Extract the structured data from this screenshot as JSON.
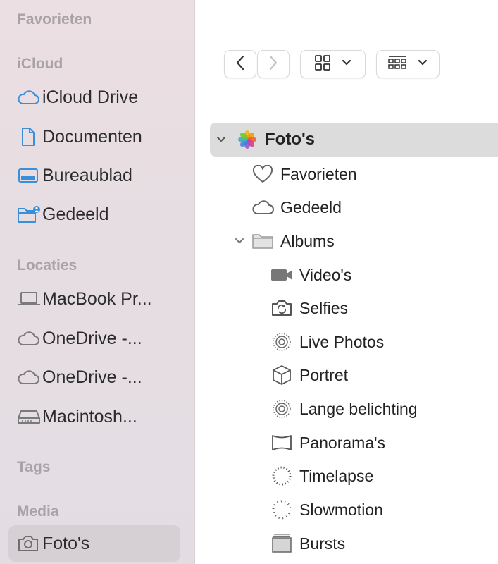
{
  "sidebar": {
    "sections": {
      "favorites": "Favorieten",
      "icloud": "iCloud",
      "locations": "Locaties",
      "tags": "Tags",
      "media": "Media"
    },
    "icloud_items": [
      {
        "label": "iCloud Drive",
        "icon": "cloud-icon"
      },
      {
        "label": "Documenten",
        "icon": "document-icon"
      },
      {
        "label": "Bureaublad",
        "icon": "desktop-icon"
      },
      {
        "label": "Gedeeld",
        "icon": "shared-folder-icon"
      }
    ],
    "location_items": [
      {
        "label": "MacBook Pr...",
        "icon": "laptop-icon"
      },
      {
        "label": "OneDrive -...",
        "icon": "cloud-icon"
      },
      {
        "label": "OneDrive -...",
        "icon": "cloud-icon"
      },
      {
        "label": "Macintosh...",
        "icon": "drive-icon"
      }
    ],
    "media_items": [
      {
        "label": "Foto's",
        "icon": "camera-icon",
        "selected": true
      }
    ]
  },
  "toolbar": {
    "back": "back-chevron-icon",
    "forward": "forward-chevron-icon",
    "view_mode": "grid-view-icon",
    "group_mode": "group-view-icon"
  },
  "outline": {
    "root": {
      "label": "Foto's",
      "icon": "photos-app-icon",
      "expanded": true
    },
    "items": [
      {
        "label": "Favorieten",
        "icon": "heart-icon"
      },
      {
        "label": "Gedeeld",
        "icon": "cloud-icon"
      },
      {
        "label": "Albums",
        "icon": "folder-icon",
        "expanded": true
      }
    ],
    "albums": [
      {
        "label": "Video's",
        "icon": "video-icon"
      },
      {
        "label": "Selfies",
        "icon": "selfie-icon"
      },
      {
        "label": "Live Photos",
        "icon": "live-photo-icon"
      },
      {
        "label": "Portret",
        "icon": "cube-icon"
      },
      {
        "label": "Lange belichting",
        "icon": "live-photo-icon"
      },
      {
        "label": "Panorama's",
        "icon": "panorama-icon"
      },
      {
        "label": "Timelapse",
        "icon": "timelapse-icon"
      },
      {
        "label": "Slowmotion",
        "icon": "slowmotion-icon"
      },
      {
        "label": "Bursts",
        "icon": "bursts-icon"
      }
    ]
  },
  "colors": {
    "accent": "#3a8fd9",
    "sidebar_text": "#2b2b2b",
    "section_header": "#a9a2a6"
  }
}
